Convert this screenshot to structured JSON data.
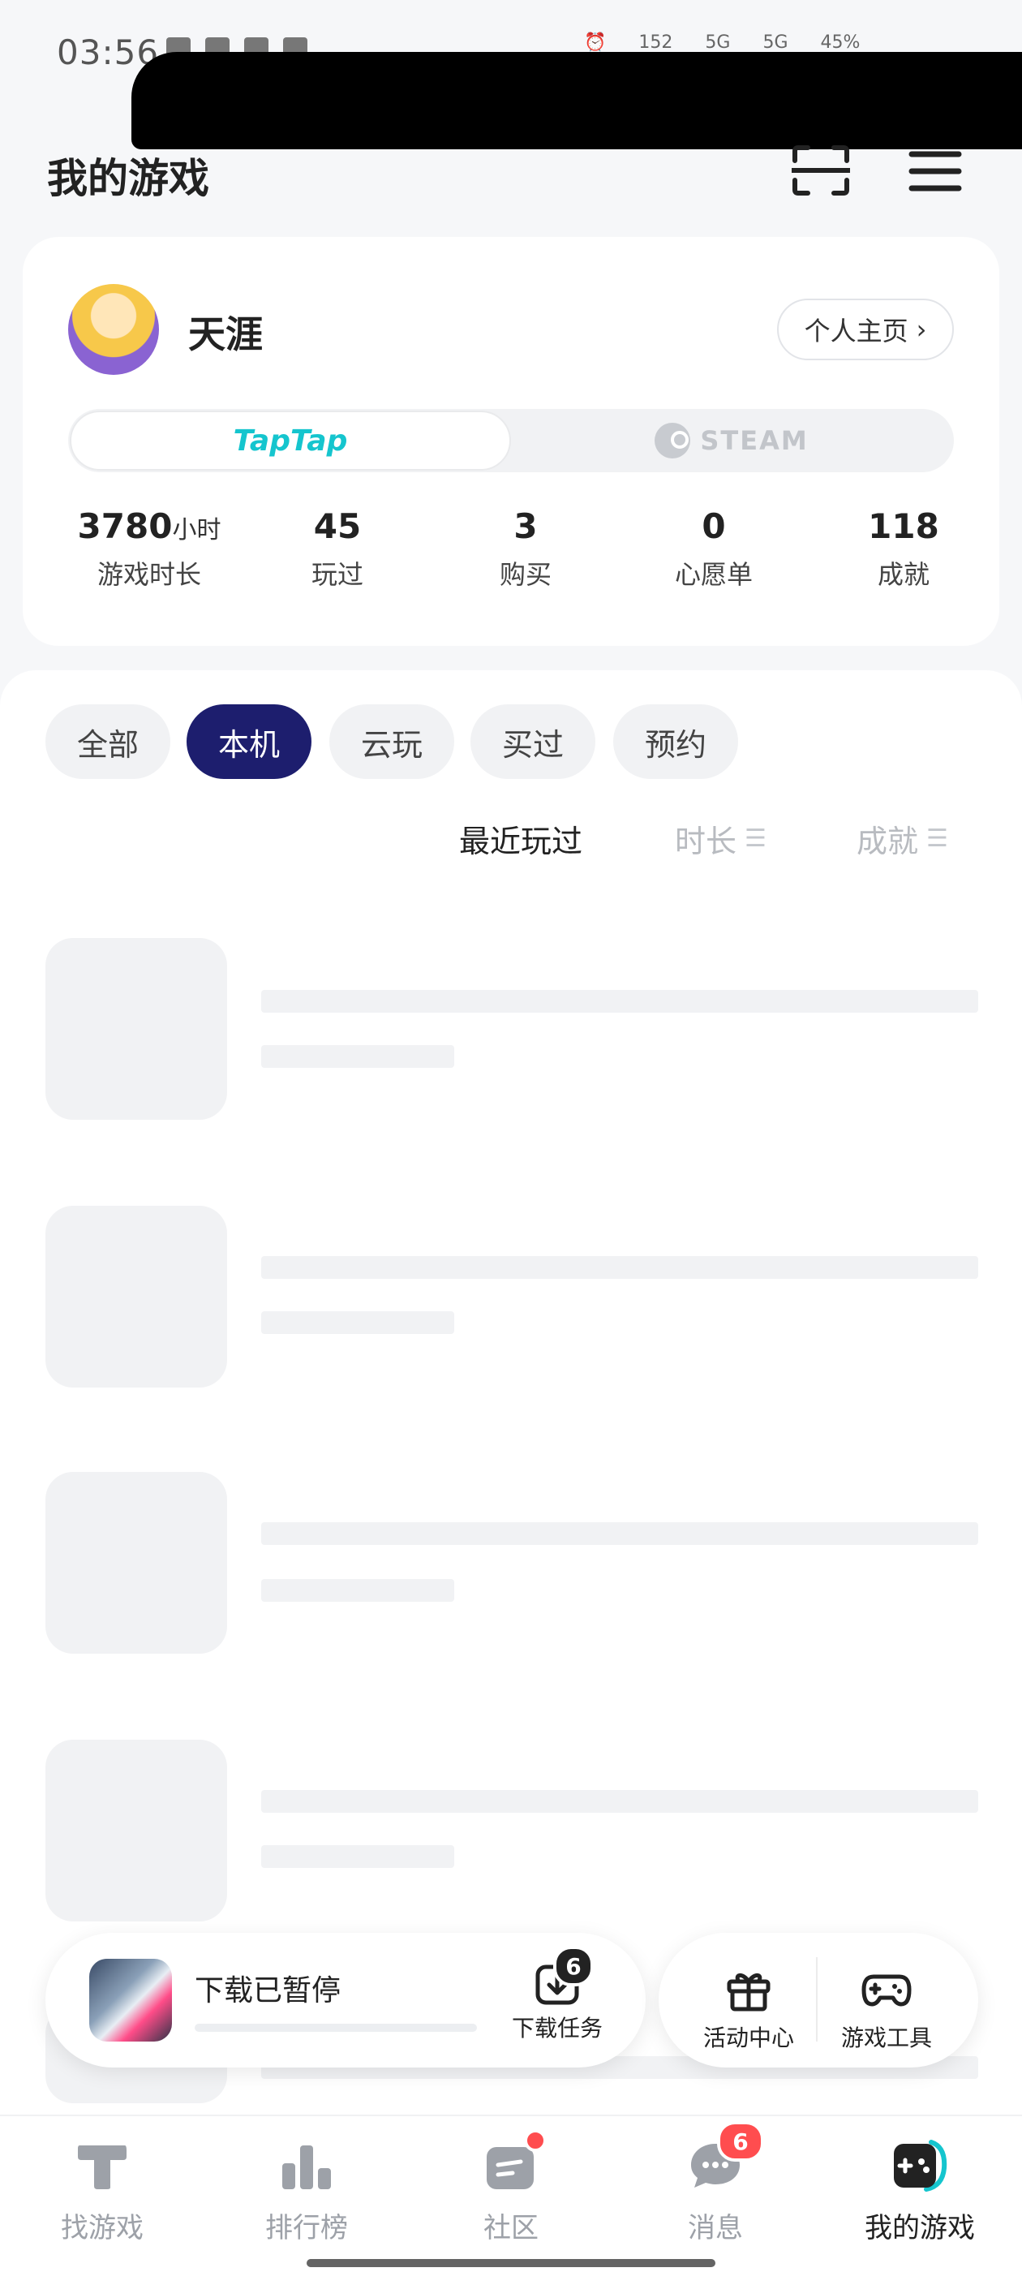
{
  "status_bar": {
    "time": "03:56",
    "right": [
      "152",
      "5G",
      "5G",
      "45%"
    ]
  },
  "header": {
    "title": "我的游戏",
    "scan_icon": "scan-icon",
    "menu_icon": "menu-icon"
  },
  "profile": {
    "username": "天涯",
    "homepage_label": "个人主页",
    "platforms": [
      {
        "label": "TapTap",
        "active": true
      },
      {
        "label": "STEAM",
        "active": false
      }
    ],
    "stats": [
      {
        "value": "3780",
        "unit": "小时",
        "label": "游戏时长"
      },
      {
        "value": "45",
        "unit": "",
        "label": "玩过"
      },
      {
        "value": "3",
        "unit": "",
        "label": "购买"
      },
      {
        "value": "0",
        "unit": "",
        "label": "心愿单"
      },
      {
        "value": "118",
        "unit": "",
        "label": "成就"
      }
    ]
  },
  "filters": [
    {
      "label": "全部",
      "active": false
    },
    {
      "label": "本机",
      "active": true
    },
    {
      "label": "云玩",
      "active": false
    },
    {
      "label": "买过",
      "active": false
    },
    {
      "label": "预约",
      "active": false
    }
  ],
  "sort": [
    {
      "label": "最近玩过",
      "active": true
    },
    {
      "label": "时长",
      "active": false
    },
    {
      "label": "成就",
      "active": false
    }
  ],
  "download": {
    "status": "下载已暂停",
    "progress": 0,
    "task_label": "下载任务",
    "task_count": "6"
  },
  "tools": [
    {
      "label": "活动中心",
      "icon": "gift-icon"
    },
    {
      "label": "游戏工具",
      "icon": "gamepad-icon"
    }
  ],
  "nav": [
    {
      "label": "找游戏",
      "icon": "find-game-icon",
      "active": false,
      "badge": ""
    },
    {
      "label": "排行榜",
      "icon": "ranking-icon",
      "active": false,
      "badge": ""
    },
    {
      "label": "社区",
      "icon": "community-icon",
      "active": false,
      "badge": "dot"
    },
    {
      "label": "消息",
      "icon": "message-icon",
      "active": false,
      "badge": "6"
    },
    {
      "label": "我的游戏",
      "icon": "my-games-icon",
      "active": true,
      "badge": ""
    }
  ],
  "colors": {
    "accent_dark": "#1d1e6e",
    "taptap": "#15c5ce",
    "badge_red": "#ff4d4f"
  }
}
